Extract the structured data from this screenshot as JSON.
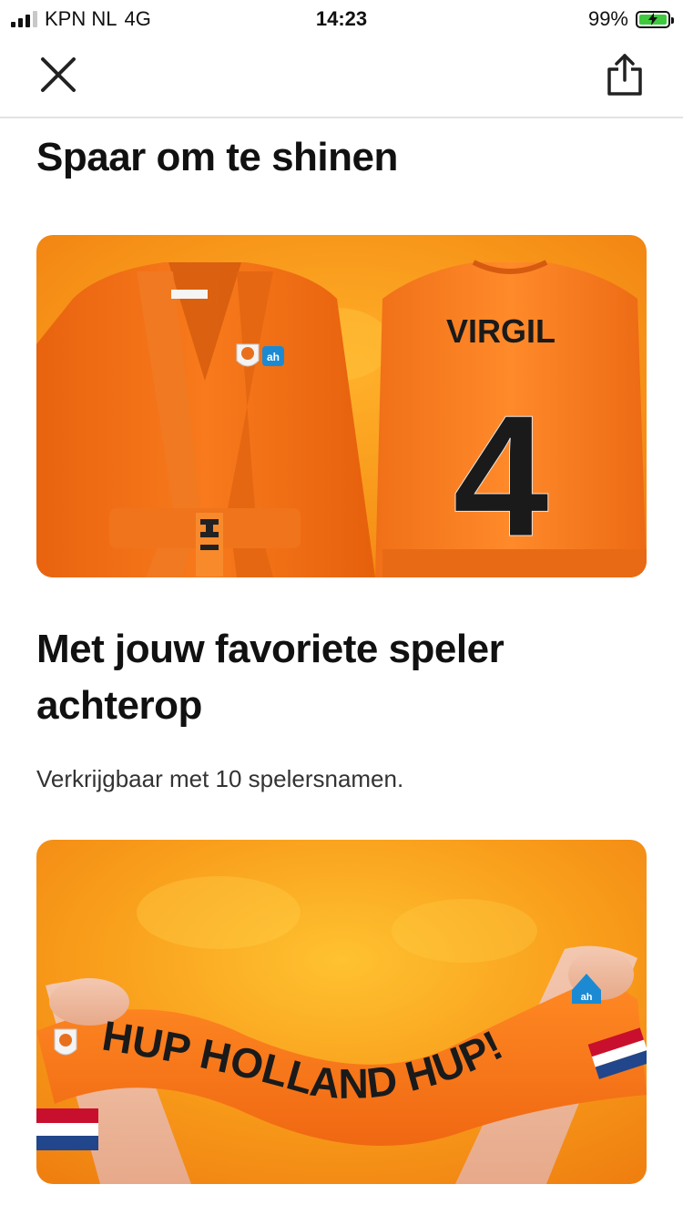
{
  "status_bar": {
    "carrier": "KPN NL",
    "network": "4G",
    "time": "14:23",
    "battery": "99%",
    "battery_level": 0.99,
    "battery_charging": true
  },
  "nav": {
    "close_icon": "close-icon",
    "share_icon": "share-icon"
  },
  "article": {
    "title": "Spaar om te shinen",
    "subtitle": "Met jouw favoriete speler achterop",
    "body": "Verkrijgbaar met 10 spelersnamen."
  },
  "card_1": {
    "back_name": "VIRGIL",
    "back_number": "4",
    "logo_text": "ah"
  },
  "card_2": {
    "scarf_text": "HUP HOLLAND HUP!",
    "logo_text": "ah"
  },
  "colors": {
    "accent_orange": "#f57a1c",
    "background": "#ffffff",
    "text": "#111111"
  }
}
